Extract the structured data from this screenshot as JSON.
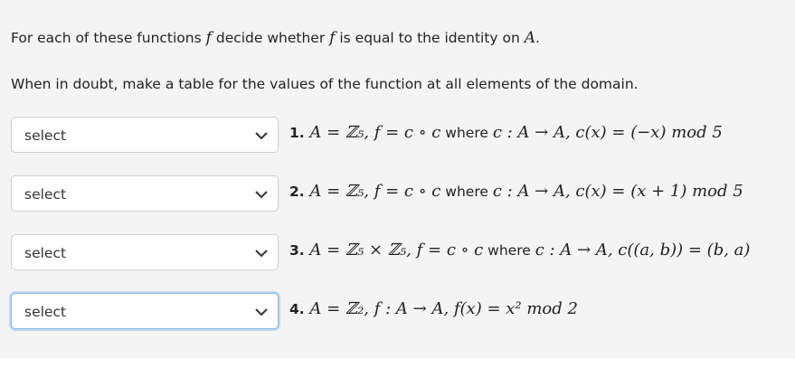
{
  "intro": {
    "line1_before": "For each of these functions ",
    "line1_f1": "f",
    "line1_mid": " decide whether ",
    "line1_f2": "f",
    "line1_after": " is equal to the identity on ",
    "line1_A": "A",
    "line1_end": ".",
    "line2": "When in doubt, make a table for the values of the function at all elements of the domain."
  },
  "questions": [
    {
      "select_value": "select",
      "number": "1.",
      "part_a": "A = ℤ₅, f = c ∘ c",
      "where": " where ",
      "part_b": "c : A → A, c(x) = (−x) mod 5"
    },
    {
      "select_value": "select",
      "number": "2.",
      "part_a": "A = ℤ₅, f = c ∘ c",
      "where": " where ",
      "part_b": "c : A → A, c(x) = (x + 1) mod 5"
    },
    {
      "select_value": "select",
      "number": "3.",
      "part_a": "A = ℤ₅ × ℤ₅, f = c ∘ c",
      "where": " where ",
      "part_b": "c : A → A, c((a, b)) = (b, a)"
    },
    {
      "select_value": "select",
      "number": "4.",
      "part_a": "A = ℤ₂, f : A → A, f(x) = x² mod 2",
      "where": "",
      "part_b": ""
    }
  ]
}
